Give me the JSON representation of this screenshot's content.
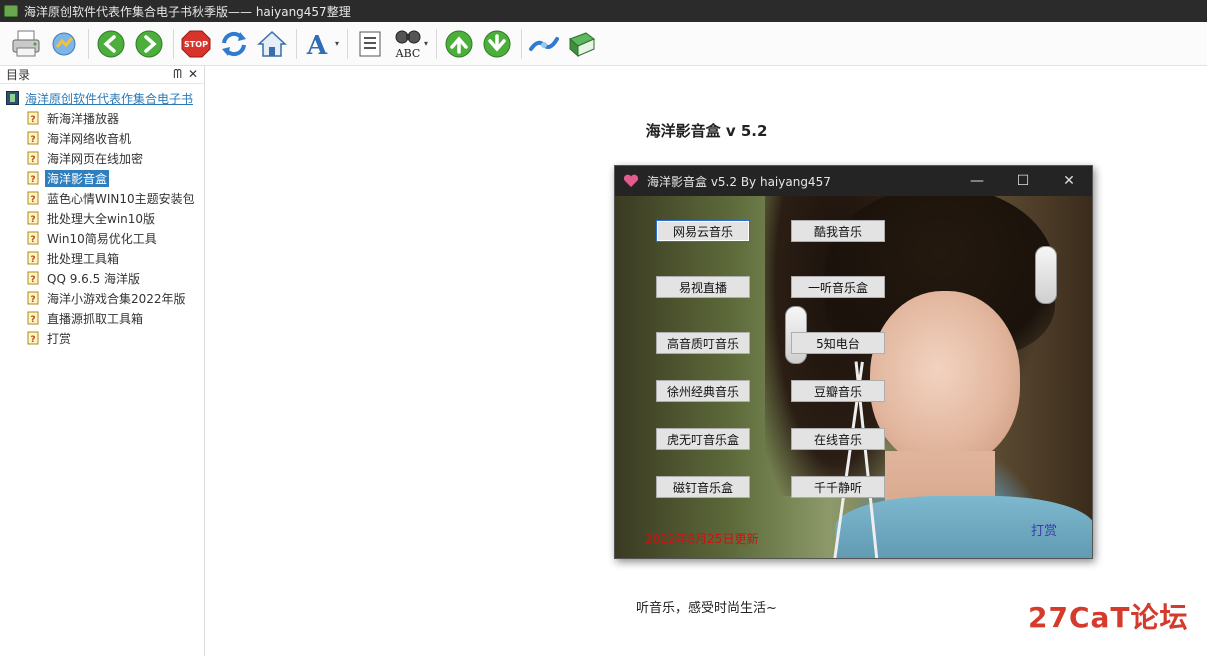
{
  "window": {
    "title": "海洋原创软件代表作集合电子书秋季版—— haiyang457整理"
  },
  "toolbar": {
    "buttons": [
      {
        "name": "print",
        "icon": "printer-icon"
      },
      {
        "name": "options",
        "icon": "options-icon"
      },
      {
        "name": "back",
        "icon": "arrow-left-icon"
      },
      {
        "name": "forward",
        "icon": "arrow-right-icon"
      },
      {
        "name": "stop",
        "icon": "stop-icon",
        "label": "STOP"
      },
      {
        "name": "refresh",
        "icon": "refresh-icon"
      },
      {
        "name": "home",
        "icon": "home-icon"
      },
      {
        "name": "font",
        "icon": "font-icon"
      },
      {
        "name": "contents",
        "icon": "contents-icon"
      },
      {
        "name": "search",
        "icon": "search-binoculars-icon",
        "label": "ABC"
      },
      {
        "name": "up",
        "icon": "arrow-up-icon"
      },
      {
        "name": "down",
        "icon": "arrow-down-icon"
      },
      {
        "name": "sync",
        "icon": "sync-icon"
      },
      {
        "name": "book",
        "icon": "book-icon"
      }
    ]
  },
  "sidebar": {
    "header": "目录",
    "pin_glyph": "ᗰ",
    "close_glyph": "✕",
    "root_label": "海洋原创软件代表作集合电子书",
    "items": [
      {
        "label": "新海洋播放器"
      },
      {
        "label": "海洋网络收音机"
      },
      {
        "label": "海洋网页在线加密"
      },
      {
        "label": "海洋影音盒",
        "selected": true
      },
      {
        "label": "蓝色心情WIN10主题安装包"
      },
      {
        "label": "批处理大全win10版"
      },
      {
        "label": "Win10简易优化工具"
      },
      {
        "label": "批处理工具箱"
      },
      {
        "label": "QQ 9.6.5 海洋版"
      },
      {
        "label": "海洋小游戏合集2022年版"
      },
      {
        "label": "直播源抓取工具箱"
      },
      {
        "label": "打赏"
      }
    ]
  },
  "content": {
    "title": "海洋影音盒 v 5.2",
    "caption": "听音乐，感受时尚生活~",
    "app_window": {
      "title": "海洋影音盒 v5.2    By haiyang457",
      "min_glyph": "—",
      "max_glyph": "☐",
      "close_glyph": "✕",
      "buttons_left": [
        "网易云音乐",
        "易视直播",
        "高音质叮音乐",
        "徐州经典音乐",
        "虎无叮音乐盒",
        "磁钉音乐盒"
      ],
      "buttons_right": [
        "酷我音乐",
        "一听音乐盒",
        "5知电台",
        "豆瓣音乐",
        "在线音乐",
        "千千静听"
      ],
      "update_note": "2022年8月25日更新",
      "tip_link": "打赏"
    }
  },
  "watermark": "27CaT论坛",
  "colors": {
    "selection": "#2f7fbf",
    "link": "#2a7ab8",
    "update_note": "#c81414",
    "watermark": "#d43b2c"
  }
}
